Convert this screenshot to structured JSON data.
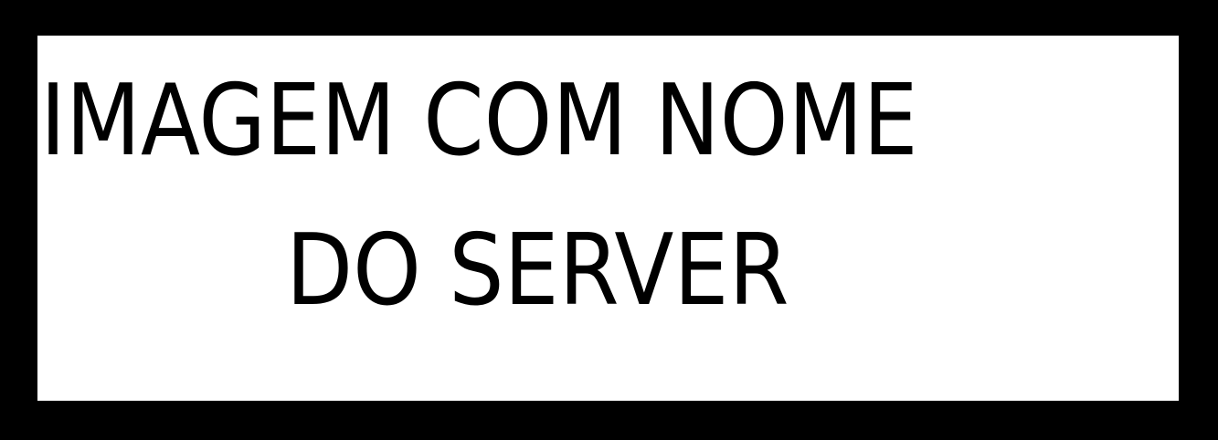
{
  "banner": {
    "line1": "IMAGEM COM NOME",
    "line2": "DO SERVER"
  },
  "colors": {
    "frame": "#000000",
    "panel": "#ffffff",
    "text": "#000000"
  }
}
